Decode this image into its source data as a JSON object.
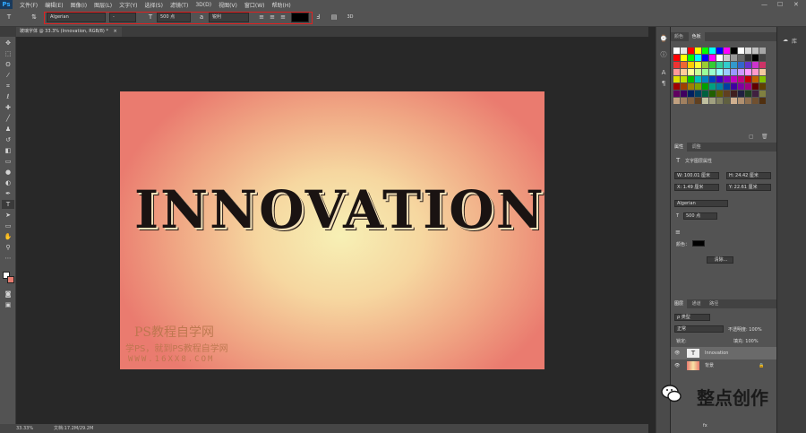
{
  "menu": {
    "logo": "Ps",
    "items": [
      "文件(F)",
      "编辑(E)",
      "图像(I)",
      "图层(L)",
      "文字(Y)",
      "选择(S)",
      "滤镜(T)",
      "3D(D)",
      "视图(V)",
      "窗口(W)",
      "帮助(H)"
    ],
    "win_min": "—",
    "win_max": "☐",
    "win_close": "✕"
  },
  "options": {
    "font_family": "Algerian",
    "font_style": "-",
    "font_size": "500 点",
    "aa_label": "a",
    "aa_mode": "锐利",
    "color": "#000000",
    "label_3d": "3D"
  },
  "document": {
    "tab_title": "玻璃字体 @ 33.3% (Innovation, RGB/8) *",
    "text": "INNOVATION",
    "watermark_title": "PS教程自学网",
    "watermark_sub": "学PS，就到PS教程自学网",
    "watermark_url": "WWW.16XX8.COM"
  },
  "status": {
    "zoom": "33.33%",
    "doc": "文档:17.2M/29.2M"
  },
  "panels": {
    "swatch_tabs": [
      "颜色",
      "色板"
    ],
    "props_tabs": [
      "属性",
      "调整"
    ],
    "props_title": "文字图层属性",
    "w": "W: 100.01 厘米",
    "h": "H: 24.42 厘米",
    "x": "X: 1.49 厘米",
    "y": "Y: 22.61 厘米",
    "font": "Algerian",
    "size": "500 点",
    "color_label": "颜色：",
    "clear_btn": "清除...",
    "layers_tabs": [
      "图层",
      "通道",
      "路径"
    ],
    "filter": "ρ 类型",
    "blend": "正常",
    "opacity": "不透明度: 100%",
    "lock": "锁定:",
    "fill": "填充: 100%",
    "layers": [
      "Innovation",
      "背景"
    ],
    "lib": "库",
    "fx": "fx"
  },
  "wechat": "整点创作",
  "colors": {
    "accent": "#e02020",
    "doc_center": "#f7f0b5",
    "doc_edge": "#ea7b6f"
  }
}
